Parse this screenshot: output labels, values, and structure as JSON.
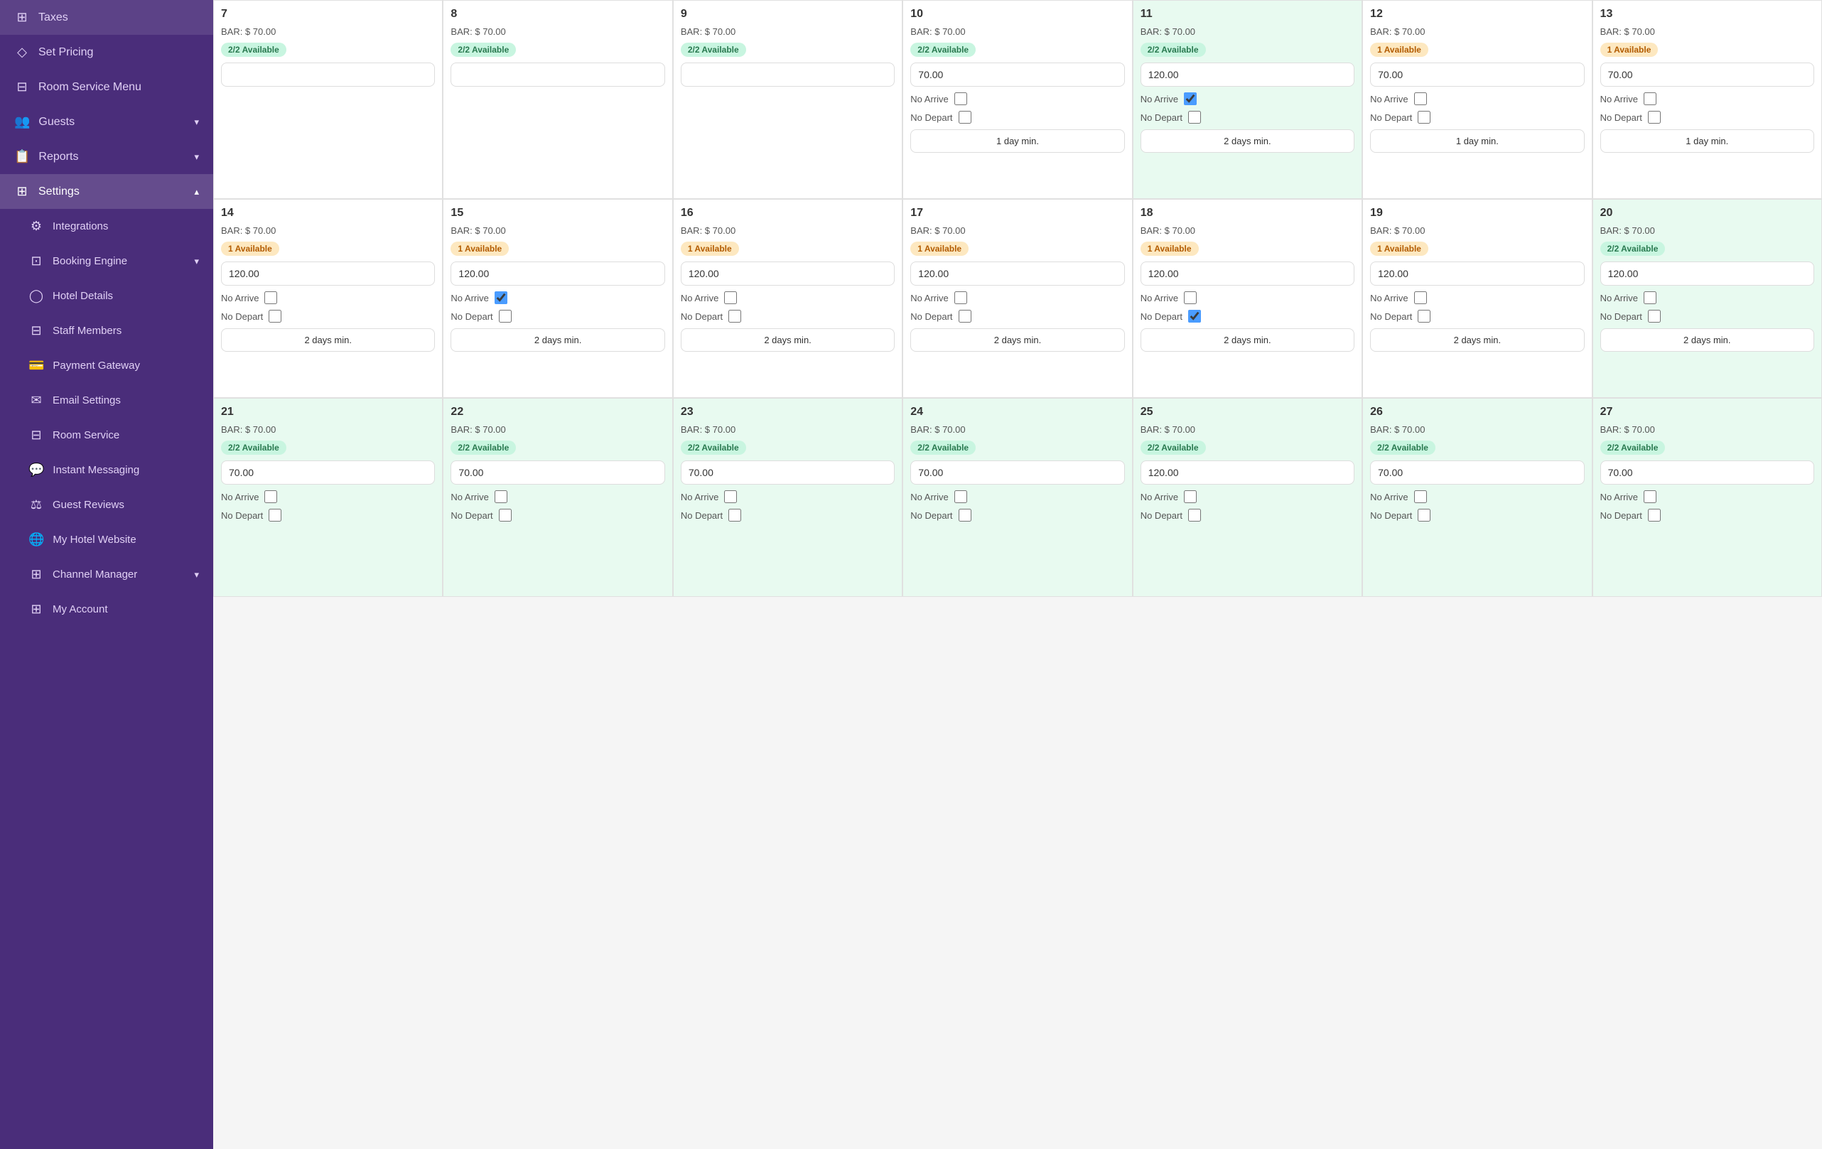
{
  "sidebar": {
    "items": [
      {
        "id": "taxes",
        "label": "Taxes",
        "icon": "⊞",
        "indent": false
      },
      {
        "id": "set-pricing",
        "label": "Set Pricing",
        "icon": "◇",
        "indent": false
      },
      {
        "id": "room-service-menu",
        "label": "Room Service Menu",
        "icon": "⊟",
        "indent": false
      },
      {
        "id": "guests",
        "label": "Guests",
        "icon": "👥",
        "indent": false,
        "chevron": "▾"
      },
      {
        "id": "reports",
        "label": "Reports",
        "icon": "📋",
        "indent": false,
        "chevron": "▾"
      },
      {
        "id": "settings",
        "label": "Settings",
        "icon": "⊞",
        "indent": false,
        "chevron": "▴",
        "active": true
      },
      {
        "id": "integrations",
        "label": "Integrations",
        "icon": "⚙",
        "indent": true
      },
      {
        "id": "booking-engine",
        "label": "Booking Engine",
        "icon": "⊡",
        "indent": true,
        "chevron": "▾"
      },
      {
        "id": "hotel-details",
        "label": "Hotel Details",
        "icon": "◯",
        "indent": true
      },
      {
        "id": "staff-members",
        "label": "Staff Members",
        "icon": "⊟",
        "indent": true
      },
      {
        "id": "payment-gateway",
        "label": "Payment Gateway",
        "icon": "💳",
        "indent": true
      },
      {
        "id": "email-settings",
        "label": "Email Settings",
        "icon": "✉",
        "indent": true
      },
      {
        "id": "room-service",
        "label": "Room Service",
        "icon": "⊟",
        "indent": true
      },
      {
        "id": "instant-messaging",
        "label": "Instant Messaging",
        "icon": "💬",
        "indent": true
      },
      {
        "id": "guest-reviews",
        "label": "Guest Reviews",
        "icon": "⚖",
        "indent": true
      },
      {
        "id": "my-hotel-website",
        "label": "My Hotel Website",
        "icon": "🌐",
        "indent": true
      },
      {
        "id": "channel-manager",
        "label": "Channel Manager",
        "icon": "⊞",
        "indent": true,
        "chevron": "▾"
      },
      {
        "id": "my-account",
        "label": "My Account",
        "icon": "⊞",
        "indent": true
      }
    ]
  },
  "calendar": {
    "rows": [
      {
        "days": [
          {
            "num": "7",
            "bar": "BAR: $ 70.00",
            "badge": "2/2 Available",
            "badgeType": "green",
            "price": "",
            "noArrive": false,
            "noDepart": false,
            "minDays": null,
            "highlight": false
          },
          {
            "num": "8",
            "bar": "BAR: $ 70.00",
            "badge": "2/2 Available",
            "badgeType": "green",
            "price": "",
            "noArrive": false,
            "noDepart": false,
            "minDays": null,
            "highlight": false
          },
          {
            "num": "9",
            "bar": "BAR: $ 70.00",
            "badge": "2/2 Available",
            "badgeType": "green",
            "price": "",
            "noArrive": false,
            "noDepart": false,
            "minDays": null,
            "highlight": false
          },
          {
            "num": "10",
            "bar": "BAR: $ 70.00",
            "badge": "2/2 Available",
            "badgeType": "green",
            "price": "70.00",
            "noArrive": false,
            "noDepart": false,
            "minDays": "1 day min.",
            "highlight": false
          },
          {
            "num": "11",
            "bar": "BAR: $ 70.00",
            "badge": "2/2 Available",
            "badgeType": "green",
            "price": "120.00",
            "noArrive": true,
            "noDepart": false,
            "minDays": "2 days min.",
            "highlight": true
          },
          {
            "num": "12",
            "bar": "BAR: $ 70.00",
            "badge": "1 Available",
            "badgeType": "orange",
            "price": "70.00",
            "noArrive": false,
            "noDepart": false,
            "minDays": "1 day min.",
            "highlight": false
          },
          {
            "num": "13",
            "bar": "BAR: $ 70.00",
            "badge": "1 Available",
            "badgeType": "orange",
            "price": "70.00",
            "noArrive": false,
            "noDepart": false,
            "minDays": "1 day min.",
            "highlight": false
          }
        ]
      },
      {
        "days": [
          {
            "num": "14",
            "bar": "BAR: $ 70.00",
            "badge": "1 Available",
            "badgeType": "orange",
            "price": "120.00",
            "noArrive": false,
            "noDepart": false,
            "minDays": "2 days min.",
            "highlight": false
          },
          {
            "num": "15",
            "bar": "BAR: $ 70.00",
            "badge": "1 Available",
            "badgeType": "orange",
            "price": "120.00",
            "noArrive": true,
            "noDepart": false,
            "minDays": "2 days min.",
            "highlight": false
          },
          {
            "num": "16",
            "bar": "BAR: $ 70.00",
            "badge": "1 Available",
            "badgeType": "orange",
            "price": "120.00",
            "noArrive": false,
            "noDepart": false,
            "minDays": "2 days min.",
            "highlight": false
          },
          {
            "num": "17",
            "bar": "BAR: $ 70.00",
            "badge": "1 Available",
            "badgeType": "orange",
            "price": "120.00",
            "noArrive": false,
            "noDepart": false,
            "minDays": "2 days min.",
            "highlight": false
          },
          {
            "num": "18",
            "bar": "BAR: $ 70.00",
            "badge": "1 Available",
            "badgeType": "orange",
            "price": "120.00",
            "noArrive": false,
            "noDepart": true,
            "minDays": "2 days min.",
            "highlight": false
          },
          {
            "num": "19",
            "bar": "BAR: $ 70.00",
            "badge": "1 Available",
            "badgeType": "orange",
            "price": "120.00",
            "noArrive": false,
            "noDepart": false,
            "minDays": "2 days min.",
            "highlight": false
          },
          {
            "num": "20",
            "bar": "BAR: $ 70.00",
            "badge": "2/2 Available",
            "badgeType": "green",
            "price": "120.00",
            "noArrive": false,
            "noDepart": false,
            "minDays": "2 days min.",
            "highlight": true
          }
        ]
      },
      {
        "days": [
          {
            "num": "21",
            "bar": "BAR: $ 70.00",
            "badge": "2/2 Available",
            "badgeType": "green",
            "price": "70.00",
            "noArrive": false,
            "noDepart": false,
            "minDays": null,
            "highlight": true
          },
          {
            "num": "22",
            "bar": "BAR: $ 70.00",
            "badge": "2/2 Available",
            "badgeType": "green",
            "price": "70.00",
            "noArrive": false,
            "noDepart": false,
            "minDays": null,
            "highlight": true
          },
          {
            "num": "23",
            "bar": "BAR: $ 70.00",
            "badge": "2/2 Available",
            "badgeType": "green",
            "price": "70.00",
            "noArrive": false,
            "noDepart": false,
            "minDays": null,
            "highlight": true
          },
          {
            "num": "24",
            "bar": "BAR: $ 70.00",
            "badge": "2/2 Available",
            "badgeType": "green",
            "price": "70.00",
            "noArrive": false,
            "noDepart": false,
            "minDays": null,
            "highlight": true
          },
          {
            "num": "25",
            "bar": "BAR: $ 70.00",
            "badge": "2/2 Available",
            "badgeType": "green",
            "price": "120.00",
            "noArrive": false,
            "noDepart": false,
            "minDays": null,
            "highlight": true
          },
          {
            "num": "26",
            "bar": "BAR: $ 70.00",
            "badge": "2/2 Available",
            "badgeType": "green",
            "price": "70.00",
            "noArrive": false,
            "noDepart": false,
            "minDays": null,
            "highlight": true
          },
          {
            "num": "27",
            "bar": "BAR: $ 70.00",
            "badge": "2/2 Available",
            "badgeType": "green",
            "price": "70.00",
            "noArrive": false,
            "noDepart": false,
            "minDays": null,
            "highlight": true
          }
        ]
      }
    ],
    "labels": {
      "noArrive": "No Arrive",
      "noDepart": "No Depart"
    }
  }
}
